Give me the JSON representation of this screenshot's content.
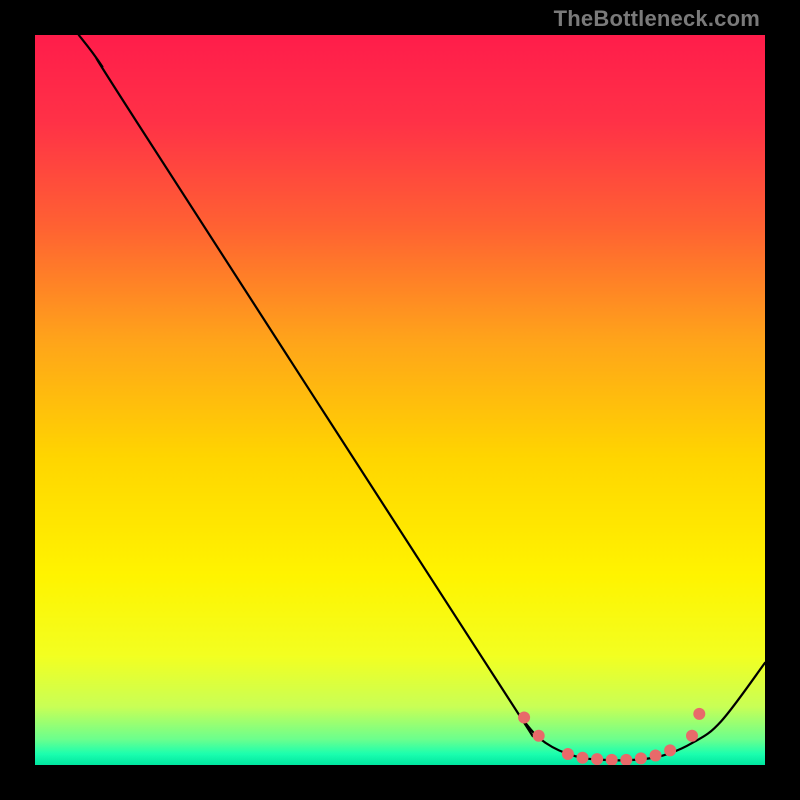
{
  "watermark": "TheBottleneck.com",
  "gradient_stops": [
    {
      "pos": 0.0,
      "color": "#ff1d4b"
    },
    {
      "pos": 0.12,
      "color": "#ff3247"
    },
    {
      "pos": 0.26,
      "color": "#ff6133"
    },
    {
      "pos": 0.42,
      "color": "#ffa51a"
    },
    {
      "pos": 0.58,
      "color": "#ffd600"
    },
    {
      "pos": 0.74,
      "color": "#fff400"
    },
    {
      "pos": 0.85,
      "color": "#f3ff21"
    },
    {
      "pos": 0.92,
      "color": "#c9ff56"
    },
    {
      "pos": 0.965,
      "color": "#6bff8e"
    },
    {
      "pos": 0.985,
      "color": "#1bffaf"
    },
    {
      "pos": 1.0,
      "color": "#00e6a0"
    }
  ],
  "chart_data": {
    "type": "line",
    "title": "",
    "xlabel": "",
    "ylabel": "",
    "xlim": [
      0,
      100
    ],
    "ylim": [
      0,
      100
    ],
    "series": [
      {
        "name": "bottleneck-curve",
        "color": "#000000",
        "width": 2.2,
        "points": [
          {
            "x": 6,
            "y": 100
          },
          {
            "x": 9,
            "y": 96
          },
          {
            "x": 14,
            "y": 88
          },
          {
            "x": 63,
            "y": 12
          },
          {
            "x": 67,
            "y": 6
          },
          {
            "x": 70,
            "y": 3
          },
          {
            "x": 74,
            "y": 1.2
          },
          {
            "x": 78,
            "y": 0.7
          },
          {
            "x": 82,
            "y": 0.7
          },
          {
            "x": 86,
            "y": 1.3
          },
          {
            "x": 90,
            "y": 3
          },
          {
            "x": 94,
            "y": 6
          },
          {
            "x": 100,
            "y": 14
          }
        ]
      }
    ],
    "markers": {
      "color": "#e86a6a",
      "radius": 6,
      "points": [
        {
          "x": 67,
          "y": 6.5
        },
        {
          "x": 69,
          "y": 4
        },
        {
          "x": 73,
          "y": 1.5
        },
        {
          "x": 75,
          "y": 1.0
        },
        {
          "x": 77,
          "y": 0.8
        },
        {
          "x": 79,
          "y": 0.7
        },
        {
          "x": 81,
          "y": 0.7
        },
        {
          "x": 83,
          "y": 0.9
        },
        {
          "x": 85,
          "y": 1.3
        },
        {
          "x": 87,
          "y": 2.0
        },
        {
          "x": 90,
          "y": 4.0
        },
        {
          "x": 91,
          "y": 7.0
        }
      ]
    }
  }
}
